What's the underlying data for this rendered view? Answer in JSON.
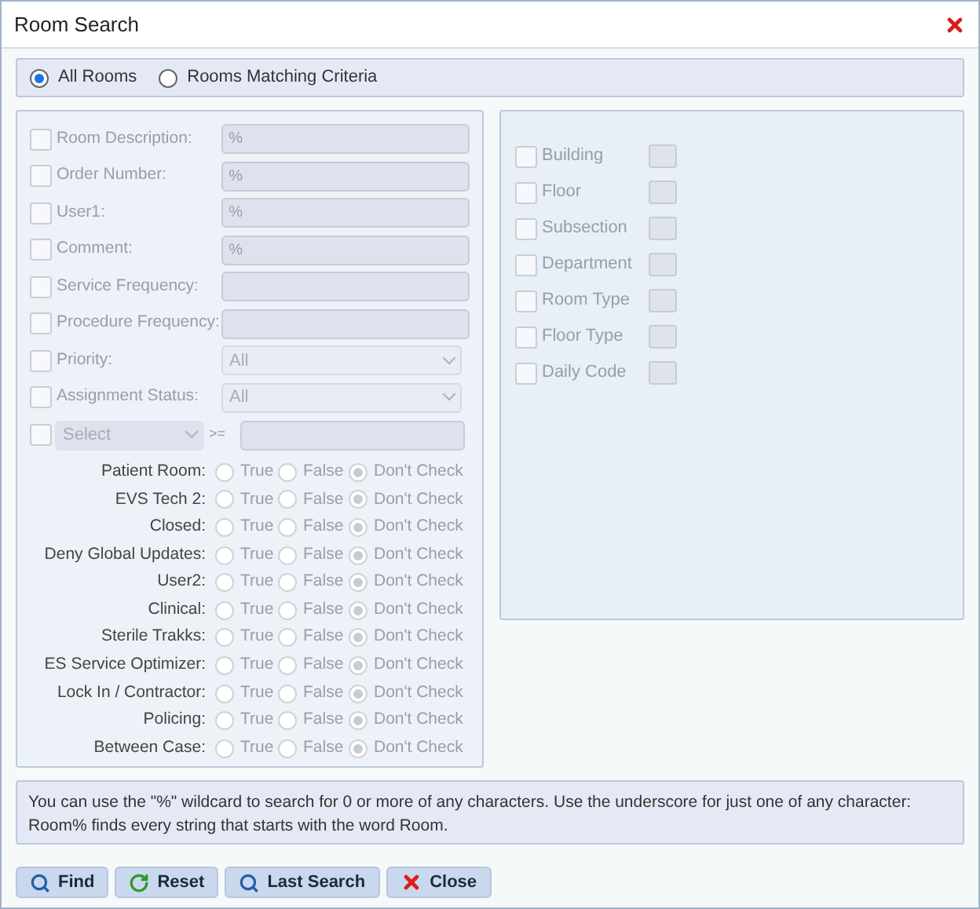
{
  "window": {
    "title": "Room Search"
  },
  "scope": [
    {
      "label": "All Rooms",
      "selected": true
    },
    {
      "label": "Rooms Matching Criteria",
      "selected": false
    }
  ],
  "criteria_disabled": true,
  "fields": [
    {
      "label": "Room Description:",
      "checked": false,
      "kind": "text",
      "value": "%"
    },
    {
      "label": "Order Number:",
      "checked": false,
      "kind": "text",
      "value": "%"
    },
    {
      "label": "User1:",
      "checked": false,
      "kind": "text",
      "value": "%"
    },
    {
      "label": "Comment:",
      "checked": false,
      "kind": "text",
      "value": "%"
    },
    {
      "label": "Service Frequency:",
      "checked": false,
      "kind": "text"
    },
    {
      "label": "Procedure Frequency:",
      "checked": false,
      "kind": "text"
    },
    {
      "label": "Priority:",
      "checked": false,
      "kind": "select",
      "value": "All"
    },
    {
      "label": "Assignment Status:",
      "checked": false,
      "kind": "select",
      "value": "All"
    }
  ],
  "compare": {
    "checked": false,
    "select": "Select",
    "operator": ">="
  },
  "flags": [
    {
      "label": "Patient Room:",
      "options": [
        {
          "label": "True",
          "selected": false
        },
        {
          "label": "False",
          "selected": false
        },
        {
          "label": "Don't Check",
          "selected": true
        }
      ]
    },
    {
      "label": "EVS Tech 2:",
      "options": [
        {
          "label": "True",
          "selected": false
        },
        {
          "label": "False",
          "selected": false
        },
        {
          "label": "Don't Check",
          "selected": true
        }
      ]
    },
    {
      "label": "Closed:",
      "options": [
        {
          "label": "True",
          "selected": false
        },
        {
          "label": "False",
          "selected": false
        },
        {
          "label": "Don't Check",
          "selected": true
        }
      ]
    },
    {
      "label": "Deny Global Updates:",
      "options": [
        {
          "label": "True",
          "selected": false
        },
        {
          "label": "False",
          "selected": false
        },
        {
          "label": "Don't Check",
          "selected": true
        }
      ]
    },
    {
      "label": "User2:",
      "options": [
        {
          "label": "True",
          "selected": false
        },
        {
          "label": "False",
          "selected": false
        },
        {
          "label": "Don't Check",
          "selected": true
        }
      ]
    },
    {
      "label": "Clinical:",
      "options": [
        {
          "label": "True",
          "selected": false
        },
        {
          "label": "False",
          "selected": false
        },
        {
          "label": "Don't Check",
          "selected": true
        }
      ]
    },
    {
      "label": "Sterile Trakks:",
      "options": [
        {
          "label": "True",
          "selected": false
        },
        {
          "label": "False",
          "selected": false
        },
        {
          "label": "Don't Check",
          "selected": true
        }
      ]
    },
    {
      "label": "ES Service Optimizer:",
      "options": [
        {
          "label": "True",
          "selected": false
        },
        {
          "label": "False",
          "selected": false
        },
        {
          "label": "Don't Check",
          "selected": true
        }
      ]
    },
    {
      "label": "Lock In / Contractor:",
      "options": [
        {
          "label": "True",
          "selected": false
        },
        {
          "label": "False",
          "selected": false
        },
        {
          "label": "Don't Check",
          "selected": true
        }
      ]
    },
    {
      "label": "Policing:",
      "options": [
        {
          "label": "True",
          "selected": false
        },
        {
          "label": "False",
          "selected": false
        },
        {
          "label": "Don't Check",
          "selected": true
        }
      ]
    },
    {
      "label": "Between Case:",
      "options": [
        {
          "label": "True",
          "selected": false
        },
        {
          "label": "False",
          "selected": false
        },
        {
          "label": "Don't Check",
          "selected": true
        }
      ]
    }
  ],
  "lookups": [
    {
      "label": "Building",
      "checked": false
    },
    {
      "label": "Floor",
      "checked": false
    },
    {
      "label": "Subsection",
      "checked": false
    },
    {
      "label": "Department",
      "checked": false
    },
    {
      "label": "Room Type",
      "checked": false
    },
    {
      "label": "Floor Type",
      "checked": false
    },
    {
      "label": "Daily Code",
      "checked": false
    }
  ],
  "info": "You can use the \"%\" wildcard to search for 0 or more of any characters. Use the underscore for just one of any character: Room% finds every string that starts with the word Room.",
  "buttons": [
    {
      "label": "Find",
      "kind": "search"
    },
    {
      "label": "Reset",
      "kind": "reset"
    },
    {
      "label": "Last Search",
      "kind": "search"
    },
    {
      "label": "Close",
      "kind": "close"
    }
  ]
}
